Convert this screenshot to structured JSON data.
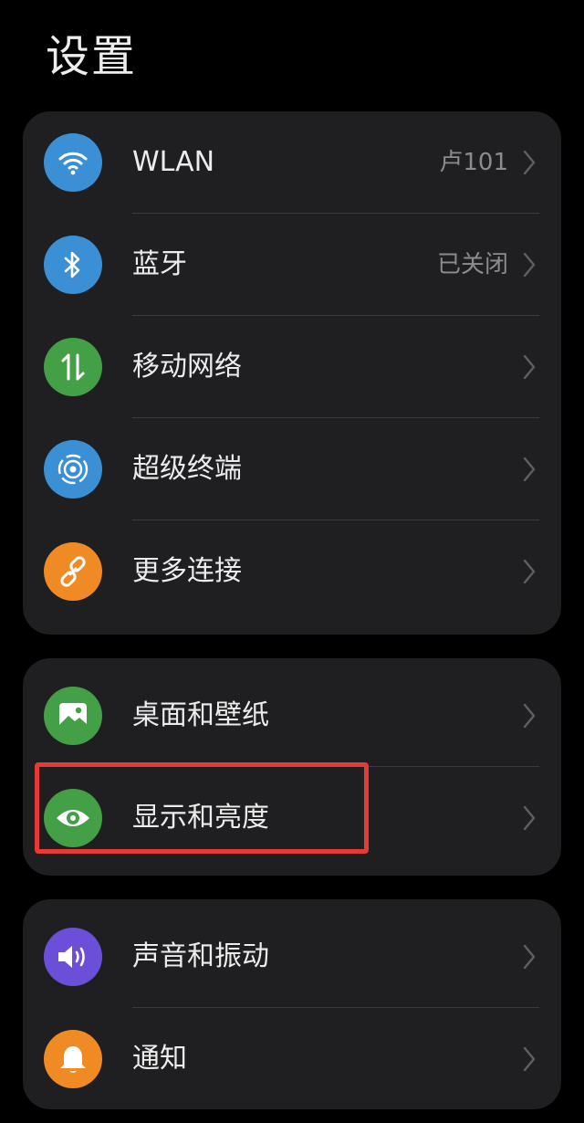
{
  "header": {
    "title": "设置"
  },
  "groups": [
    {
      "items": [
        {
          "label": "WLAN",
          "value": "卢101",
          "icon": "wifi-icon",
          "icon_color": "#3b8fd4"
        },
        {
          "label": "蓝牙",
          "value": "已关闭",
          "icon": "bluetooth-icon",
          "icon_color": "#3b8fd4"
        },
        {
          "label": "移动网络",
          "value": "",
          "icon": "mobile-data-icon",
          "icon_color": "#43a047"
        },
        {
          "label": "超级终端",
          "value": "",
          "icon": "super-device-icon",
          "icon_color": "#3b8fd4"
        },
        {
          "label": "更多连接",
          "value": "",
          "icon": "link-icon",
          "icon_color": "#f08a24"
        }
      ]
    },
    {
      "items": [
        {
          "label": "桌面和壁纸",
          "value": "",
          "icon": "wallpaper-icon",
          "icon_color": "#43a047"
        },
        {
          "label": "显示和亮度",
          "value": "",
          "icon": "eye-icon",
          "icon_color": "#43a047"
        }
      ]
    },
    {
      "items": [
        {
          "label": "声音和振动",
          "value": "",
          "icon": "speaker-icon",
          "icon_color": "#6b4fd8"
        },
        {
          "label": "通知",
          "value": "",
          "icon": "bell-icon",
          "icon_color": "#f08a24"
        }
      ]
    }
  ],
  "highlight": {
    "color": "#e53a35",
    "target": "显示和亮度"
  }
}
